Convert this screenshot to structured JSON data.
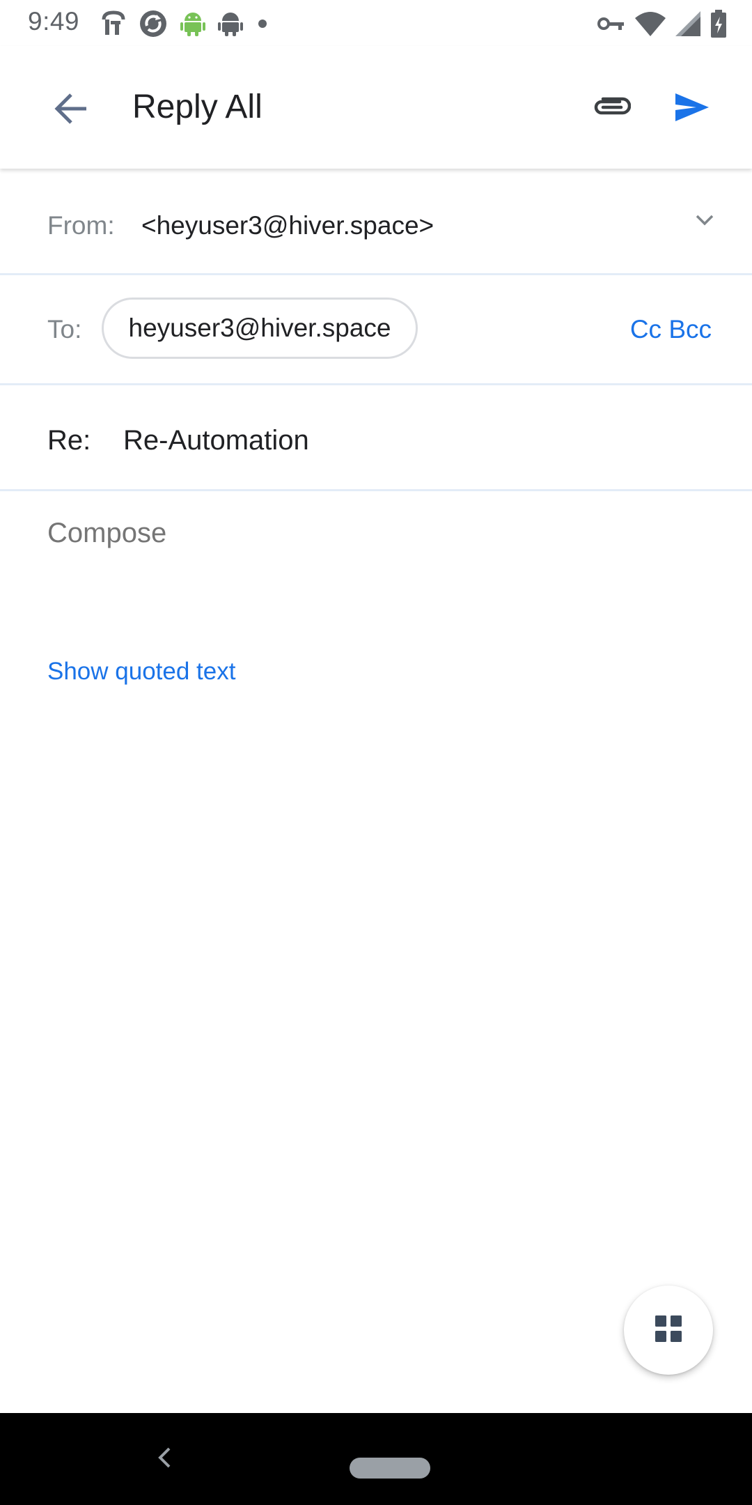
{
  "status_bar": {
    "time": "9:49",
    "left_icons": [
      "fork-icon",
      "sync-icon",
      "android-icon",
      "android-outline-icon",
      "dot-icon"
    ],
    "right_icons": [
      "vpn-key-icon",
      "wifi-icon",
      "cell-signal-icon",
      "battery-charging-icon"
    ]
  },
  "app_bar": {
    "title": "Reply All",
    "back_icon": "arrow-back-icon",
    "attach_icon": "paperclip-icon",
    "send_icon": "send-icon"
  },
  "from": {
    "label": "From:",
    "value": "<heyuser3@hiver.space>",
    "dropdown_icon": "chevron-down-icon"
  },
  "to": {
    "label": "To:",
    "recipients": [
      "heyuser3@hiver.space"
    ],
    "cc_bcc_label": "Cc Bcc"
  },
  "subject": {
    "label": "Re:",
    "value": "Re-Automation"
  },
  "compose": {
    "placeholder": "Compose",
    "value": ""
  },
  "quoted": {
    "link_label": "Show quoted text"
  },
  "fab": {
    "icon": "grid-apps-icon"
  },
  "nav_bar": {
    "back_icon": "nav-back-icon",
    "home_icon": "home-pill-icon"
  },
  "colors": {
    "accent": "#1a73e8",
    "label_gray": "#80868b",
    "divider": "#e3ecf7",
    "nav_background": "#000000"
  }
}
